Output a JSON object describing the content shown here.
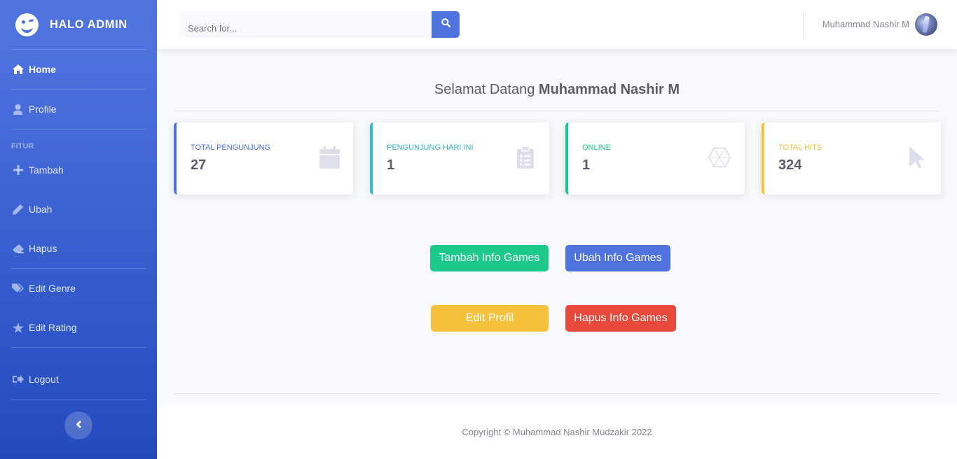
{
  "brand": {
    "title": "HALO ADMIN"
  },
  "sidebar": {
    "heading": "FITUR",
    "items": [
      {
        "label": "Home",
        "icon": "home-icon"
      },
      {
        "label": "Profile",
        "icon": "user-icon"
      },
      {
        "label": "Tambah",
        "icon": "plus-icon"
      },
      {
        "label": "Ubah",
        "icon": "pencil-icon"
      },
      {
        "label": "Hapus",
        "icon": "eraser-icon"
      },
      {
        "label": "Edit Genre",
        "icon": "tags-icon"
      },
      {
        "label": "Edit Rating",
        "icon": "star-icon"
      },
      {
        "label": "Logout",
        "icon": "sign-out-icon"
      }
    ]
  },
  "topbar": {
    "search_placeholder": "Search for...",
    "user_name": "Muhammad Nashir M"
  },
  "welcome": {
    "prefix": "Selamat Datang",
    "name": "Muhammad Nashir M"
  },
  "cards": [
    {
      "label": "TOTAL PENGUNJUNG",
      "value": "27",
      "color": "#4e73df",
      "icon": "calendar-icon"
    },
    {
      "label": "PENGUNJUNG HARI INI",
      "value": "1",
      "color": "#36b9cc",
      "icon": "clipboard-list-icon"
    },
    {
      "label": "ONLINE",
      "value": "1",
      "color": "#1cc88a",
      "icon": "hexagon-icon"
    },
    {
      "label": "TOTAL HITS",
      "value": "324",
      "color": "#f6c23e",
      "icon": "mouse-pointer-icon"
    }
  ],
  "actions": {
    "tambah": "Tambah Info Games",
    "ubah": "Ubah Info Games",
    "edit_profil": "Edit Profil",
    "hapus": "Hapus Info Games"
  },
  "colors": {
    "primary": "#4e73df",
    "success": "#1cc88a",
    "warning": "#f6c23e",
    "danger": "#e74a3b",
    "info": "#36b9cc"
  },
  "footer": {
    "copyright": "Copyright © Muhammad Nashir Mudzakir 2022"
  }
}
